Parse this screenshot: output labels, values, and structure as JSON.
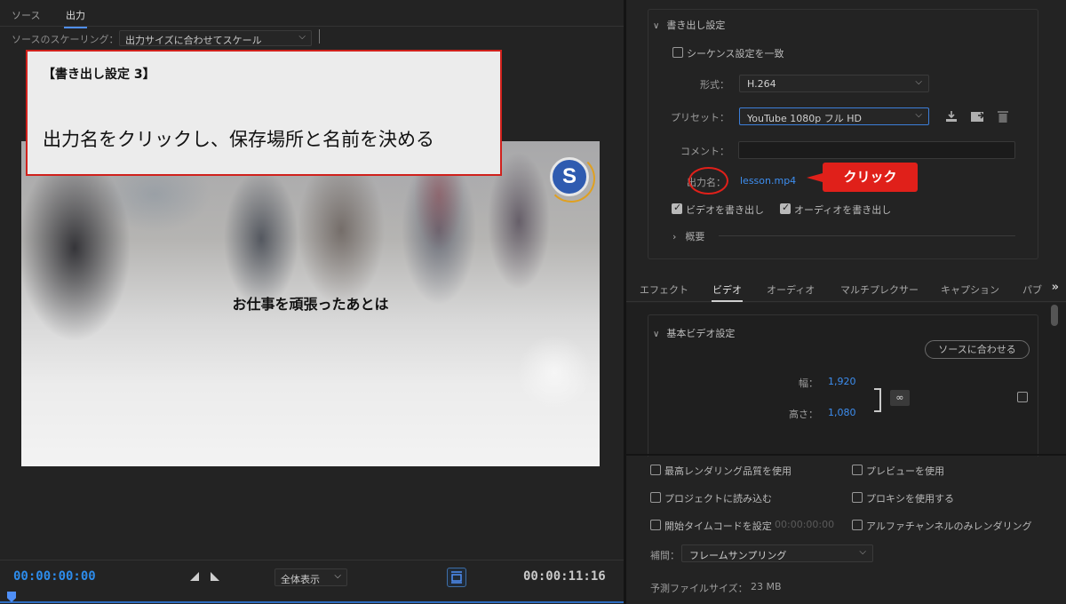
{
  "source_monitor": {
    "tabs": [
      "ソース",
      "出力"
    ],
    "scaling_label": "ソースのスケーリング：",
    "scaling_value": "出力サイズに合わせてスケール",
    "video_caption": "お仕事を頑張ったあとは",
    "logo_letter": "S",
    "timecode_start": "00:00:00:00",
    "timecode_end": "00:00:11:16",
    "fit_value": "全体表示"
  },
  "overlay": {
    "title": "【書き出し設定 3】",
    "instruction": "出力名をクリックし、保存場所と名前を決める"
  },
  "export_settings": {
    "section_title": "書き出し設定",
    "match_sequence_label": "シーケンス設定を一致",
    "format_label": "形式：",
    "format_value": "H.264",
    "preset_label": "プリセット：",
    "preset_value": "YouTube  1080p フル HD",
    "comment_label": "コメント：",
    "output_name_label": "出力名：",
    "output_name_value": "lesson.mp4",
    "click_callout": "クリック",
    "export_video_label": "ビデオを書き出し",
    "export_audio_label": "オーディオを書き出し",
    "summary_label": "概要"
  },
  "settings_tabs": [
    "エフェクト",
    "ビデオ",
    "オーディオ",
    "マルチプレクサー",
    "キャプション",
    "パブ"
  ],
  "video_settings": {
    "section_title": "基本ビデオ設定",
    "match_source_button": "ソースに合わせる",
    "width_label": "幅：",
    "width_value": "1,920",
    "height_label": "高さ：",
    "height_value": "1,080"
  },
  "footer": {
    "max_render_quality": "最高レンダリング品質を使用",
    "use_previews": "プレビューを使用",
    "import_into_project": "プロジェクトに読み込む",
    "use_proxies": "プロキシを使用する",
    "set_start_timecode": "開始タイムコードを設定",
    "start_timecode_value": "00:00:00:00",
    "render_alpha_only": "アルファチャンネルのみレンダリング",
    "interpolation_label": "補間：",
    "interpolation_value": "フレームサンプリング",
    "estimated_size_label": "予測ファイルサイズ：",
    "estimated_size_value": "23 MB"
  },
  "colors": {
    "accent_blue": "#3d8ef0",
    "callout_red": "#e0201a",
    "panel_bg": "#232323"
  }
}
